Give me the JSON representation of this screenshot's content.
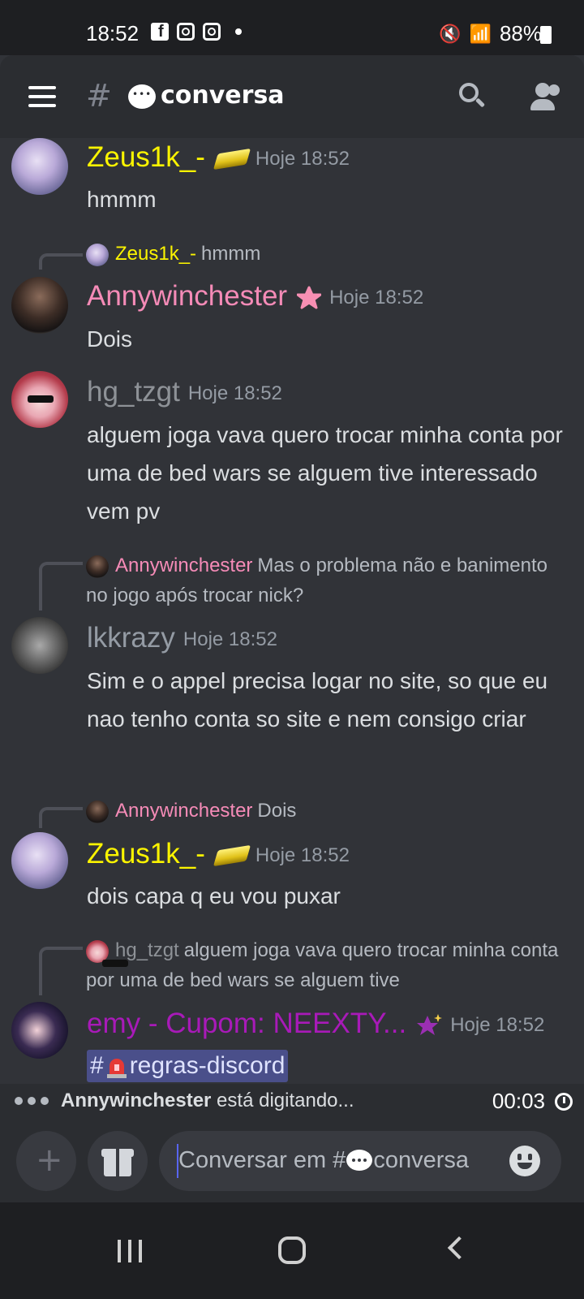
{
  "status_bar": {
    "time": "18:52",
    "battery": "88%",
    "icons_left": [
      "facebook-icon",
      "instagram-icon",
      "instagram-icon",
      "dot-icon"
    ],
    "icons_right": [
      "mute-icon",
      "wifi-icon",
      "signal-icon",
      "battery-icon"
    ]
  },
  "header": {
    "channel_name": "conversa",
    "icons": [
      "menu-icon",
      "hash-icon",
      "speech-bubble-icon",
      "search-icon",
      "members-icon"
    ]
  },
  "messages": [
    {
      "author": "Zeus1k_-",
      "timestamp": "Hoje 18:52",
      "text": "hmmm",
      "badge": "gold-ingot-icon"
    },
    {
      "reply_to": {
        "author": "Zeus1k_-",
        "text": "hmmm"
      },
      "author": "Annywinchester",
      "timestamp": "Hoje 18:52",
      "text": "Dois",
      "badge": "pink-flower-icon"
    },
    {
      "author": "hg_tzgt",
      "timestamp": "Hoje 18:52",
      "text": "alguem joga vava quero trocar minha conta por uma de bed wars se alguem tive interessado vem pv"
    },
    {
      "reply_to": {
        "author": "Annywinchester",
        "text": "Mas o problema não e banimento no jogo após trocar nick?"
      },
      "author": "lkkrazy",
      "timestamp": "Hoje 18:52",
      "text": "Sim e o appel precisa logar no site, so que eu nao tenho conta so site e nem consigo criar"
    },
    {
      "reply_to": {
        "author": "Annywinchester",
        "text": "Dois"
      },
      "author": "Zeus1k_-",
      "timestamp": "Hoje 18:52",
      "text": "dois capa q eu vou puxar",
      "badge": "gold-ingot-icon"
    },
    {
      "reply_to": {
        "author": "hg_tzgt",
        "text": "alguem joga vava quero trocar minha conta por uma de bed wars se alguem tive"
      },
      "author": "emy - Cupom: NEEXTY...",
      "timestamp": "Hoje 18:52",
      "mention_prefix": "#",
      "mention_channel": "regras-discord",
      "badge": "purple-star-icon"
    }
  ],
  "typing": {
    "user": "Annywinchester",
    "suffix": " está digitando...",
    "slowmode_timer": "00:03"
  },
  "composer": {
    "placeholder_prefix": "Conversar em #",
    "placeholder_channel": "conversa"
  },
  "colors": {
    "background": "#313338",
    "zeus": "#fbf400",
    "anny": "#f58bb7",
    "hg": "#8e9297",
    "lkkrazy": "#949ba4",
    "emy": "#a81ab8",
    "accent": "#5865f2"
  }
}
